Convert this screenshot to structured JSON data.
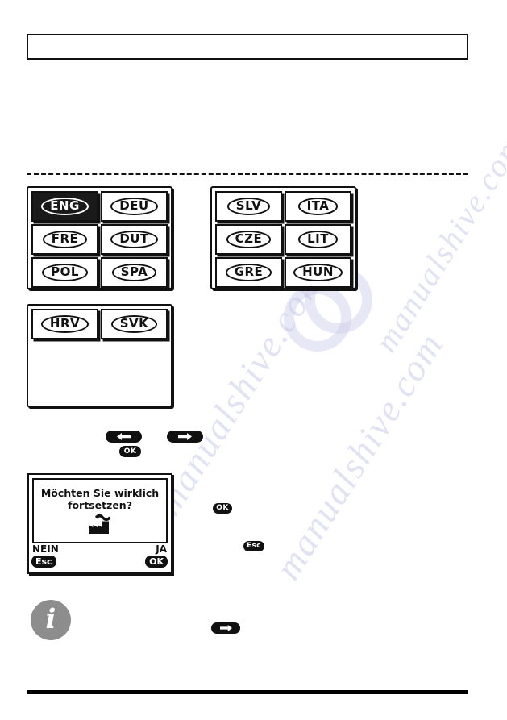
{
  "page": {
    "top_box_text": "",
    "language": "de"
  },
  "language_panels": [
    {
      "name": "panel-1",
      "keys": [
        {
          "code": "ENG",
          "selected": true
        },
        {
          "code": "DEU",
          "selected": false
        },
        {
          "code": "FRE",
          "selected": false
        },
        {
          "code": "DUT",
          "selected": false
        },
        {
          "code": "POL",
          "selected": false
        },
        {
          "code": "SPA",
          "selected": false
        }
      ]
    },
    {
      "name": "panel-2",
      "keys": [
        {
          "code": "SLV",
          "selected": false
        },
        {
          "code": "ITA",
          "selected": false
        },
        {
          "code": "CZE",
          "selected": false
        },
        {
          "code": "LIT",
          "selected": false
        },
        {
          "code": "GRE",
          "selected": false
        },
        {
          "code": "HUN",
          "selected": false
        }
      ]
    },
    {
      "name": "panel-3",
      "keys": [
        {
          "code": "HRV",
          "selected": false
        },
        {
          "code": "SVK",
          "selected": false
        }
      ]
    }
  ],
  "key_badges": {
    "left_arrow": {
      "icon": "arrow-left-icon",
      "label": ""
    },
    "right_arrow": {
      "icon": "arrow-right-icon",
      "label": ""
    },
    "ok_nav": {
      "label": "OK"
    },
    "ok_side": {
      "label": "OK"
    },
    "esc_side": {
      "label": "Esc"
    },
    "right_arrow_bottom": {
      "icon": "arrow-right-icon",
      "label": ""
    }
  },
  "dialog": {
    "message_line_1": "Möchten Sie wirklich",
    "message_line_2": "fortsetzen?",
    "icon": "factory-icon",
    "no_label": "NEIN",
    "yes_label": "JA",
    "no_key": "Esc",
    "yes_key": "OK"
  },
  "info": {
    "icon": "info-icon",
    "glyph": "i",
    "color": "#8d8d8d"
  },
  "watermark": {
    "line_1": "manualshive.com",
    "line_2": "manualshive.com",
    "line_3": "manualshive.com"
  },
  "colors": {
    "ink": "#111111",
    "paper": "#ffffff",
    "info_gray": "#8d8d8d",
    "watermark_blue": "#c9cbe8"
  }
}
